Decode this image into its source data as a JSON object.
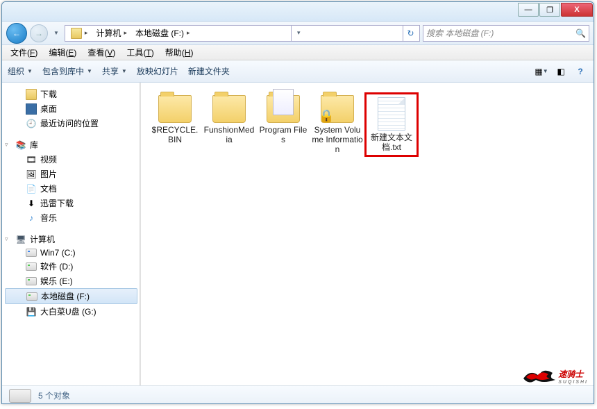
{
  "titlebar": {
    "min": "—",
    "max": "❐",
    "close": "X"
  },
  "nav": {
    "back": "←",
    "fwd": "→",
    "breadcrumb": [
      "计算机",
      "本地磁盘 (F:)"
    ],
    "refresh": "↻",
    "search_placeholder": "搜索 本地磁盘 (F:)",
    "search_icon": "🔍"
  },
  "menubar": [
    {
      "label": "文件",
      "key": "F"
    },
    {
      "label": "编辑",
      "key": "E"
    },
    {
      "label": "查看",
      "key": "V"
    },
    {
      "label": "工具",
      "key": "T"
    },
    {
      "label": "帮助",
      "key": "H"
    }
  ],
  "toolbar": {
    "organize": "组织",
    "include": "包含到库中",
    "share": "共享",
    "slideshow": "放映幻灯片",
    "newfolder": "新建文件夹",
    "help": "?"
  },
  "sidebar": {
    "fav": {
      "downloads": "下载",
      "desktop": "桌面",
      "recent": "最近访问的位置"
    },
    "lib": {
      "header": "库",
      "video": "视频",
      "pictures": "图片",
      "documents": "文档",
      "xunlei": "迅雷下载",
      "music": "音乐"
    },
    "computer": {
      "header": "计算机",
      "drives": [
        "Win7 (C:)",
        "软件 (D:)",
        "娱乐 (E:)",
        "本地磁盘 (F:)",
        "大白菜U盘 (G:)"
      ]
    }
  },
  "files": [
    {
      "name": "$RECYCLE.BIN",
      "type": "folder"
    },
    {
      "name": "FunshionMedia",
      "type": "folder"
    },
    {
      "name": "Program Files",
      "type": "folder-files"
    },
    {
      "name": "System Volume Information",
      "type": "folder-lock"
    },
    {
      "name": "新建文本文档.txt",
      "type": "txt",
      "highlight": true
    }
  ],
  "status": {
    "text": "5 个对象"
  },
  "watermark": {
    "brand": "速骑士",
    "sub": "SUQISHI"
  }
}
